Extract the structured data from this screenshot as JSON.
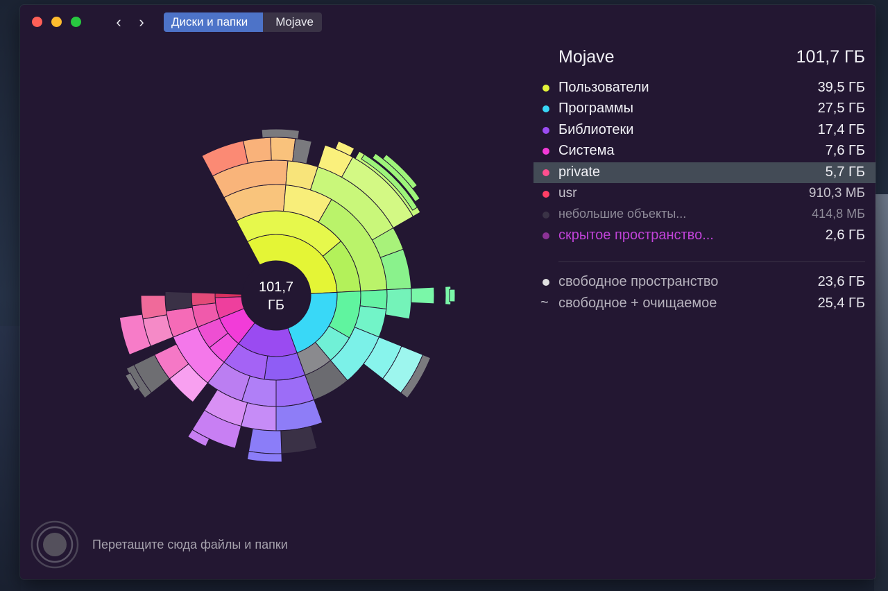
{
  "toolbar": {
    "back_icon": "chevron-left-icon",
    "forward_icon": "chevron-right-icon",
    "breadcrumb": [
      "Диски и папки",
      "Mojave"
    ]
  },
  "chart": {
    "center_value": "101,7",
    "center_unit": "ГБ"
  },
  "panel": {
    "title": "Mojave",
    "total": "101,7 ГБ",
    "items": [
      {
        "name": "Пользователи",
        "size": "39,5 ГБ",
        "color": "#e4f33a"
      },
      {
        "name": "Программы",
        "size": "27,5 ГБ",
        "color": "#38d6f6"
      },
      {
        "name": "Библиотеки",
        "size": "17,4 ГБ",
        "color": "#9b4cf2"
      },
      {
        "name": "Система",
        "size": "7,6 ГБ",
        "color": "#f23ad7"
      },
      {
        "name": "private",
        "size": "5,7 ГБ",
        "color": "#ff4f8f"
      },
      {
        "name": "usr",
        "size": "910,3 МБ",
        "color": "#ff3f66"
      },
      {
        "name": "небольшие объекты...",
        "size": "414,8 МБ",
        "color": "#3a3346"
      },
      {
        "name": "скрытое пространство...",
        "size": "2,6 ГБ",
        "color": "#8b3296"
      }
    ],
    "free": {
      "name": "свободное пространство",
      "size": "23,6 ГБ",
      "color": "#e0e0e0"
    },
    "purgeable": {
      "name": "свободное + очищаемое",
      "size": "25,4 ГБ",
      "icon": "tilde-icon"
    }
  },
  "footer": {
    "drop_hint": "Перетащите сюда файлы и папки"
  }
}
